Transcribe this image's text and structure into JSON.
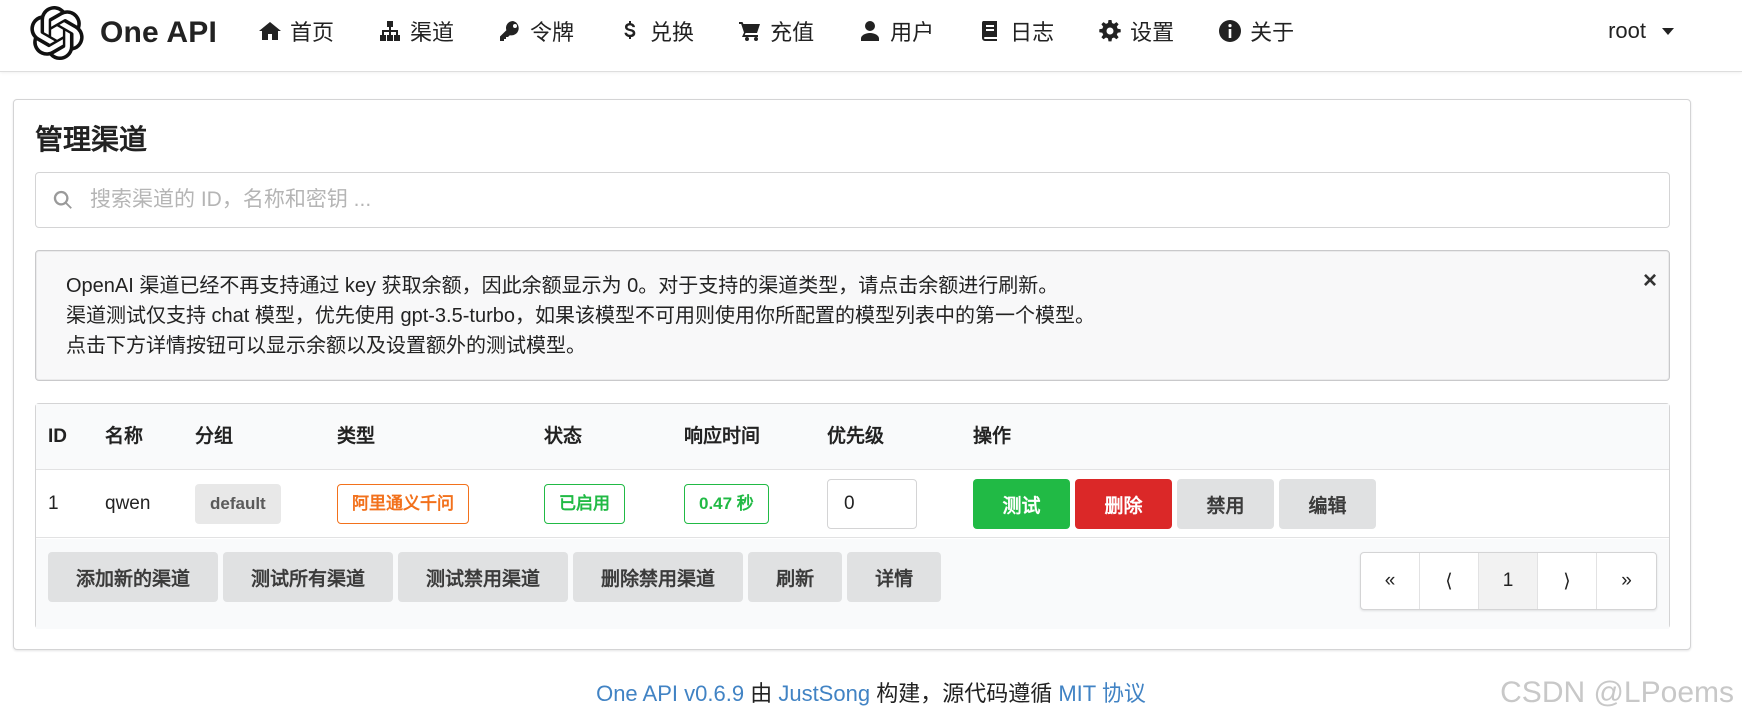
{
  "brand": {
    "name": "One API"
  },
  "nav": {
    "items": [
      {
        "label": "首页",
        "icon": "home-icon"
      },
      {
        "label": "渠道",
        "icon": "sitemap-icon"
      },
      {
        "label": "令牌",
        "icon": "key-icon"
      },
      {
        "label": "兑换",
        "icon": "dollar-icon"
      },
      {
        "label": "充值",
        "icon": "cart-icon"
      },
      {
        "label": "用户",
        "icon": "user-icon"
      },
      {
        "label": "日志",
        "icon": "book-icon"
      },
      {
        "label": "设置",
        "icon": "gear-icon"
      },
      {
        "label": "关于",
        "icon": "info-icon"
      }
    ],
    "user": "root"
  },
  "page": {
    "title": "管理渠道",
    "search_placeholder": "搜索渠道的 ID，名称和密钥 ..."
  },
  "notice": {
    "lines": [
      "OpenAI 渠道已经不再支持通过 key 获取余额，因此余额显示为 0。对于支持的渠道类型，请点击余额进行刷新。",
      "渠道测试仅支持 chat 模型，优先使用 gpt-3.5-turbo，如果该模型不可用则使用你所配置的模型列表中的第一个模型。",
      "点击下方详情按钮可以显示余额以及设置额外的测试模型。"
    ],
    "close": "×"
  },
  "table": {
    "headers": {
      "id": "ID",
      "name": "名称",
      "group": "分组",
      "type": "类型",
      "status": "状态",
      "response_time": "响应时间",
      "priority": "优先级",
      "actions": "操作"
    },
    "rows": [
      {
        "id": "1",
        "name": "qwen",
        "group": "default",
        "type": "阿里通义千问",
        "status": "已启用",
        "response_time": "0.47 秒",
        "priority": "0",
        "actions": {
          "test": "测试",
          "delete": "删除",
          "disable": "禁用",
          "edit": "编辑"
        }
      }
    ],
    "footer_buttons": {
      "add": "添加新的渠道",
      "test_all": "测试所有渠道",
      "test_disabled": "测试禁用渠道",
      "delete_disabled": "删除禁用渠道",
      "refresh": "刷新",
      "details": "详情"
    },
    "pagination": {
      "first": "«",
      "prev": "⟨",
      "current": "1",
      "next": "⟩",
      "last": "»"
    }
  },
  "footer": {
    "app_version": "One API v0.6.9",
    "by": "由",
    "author": "JustSong",
    "built": "构建，源代码遵循",
    "license": "MIT 协议"
  },
  "watermark": "CSDN @LPoems",
  "colors": {
    "green": "#21ba45",
    "red": "#db2828",
    "orange": "#f2711c",
    "link": "#4183c4",
    "grey_button": "#e0e1e2"
  }
}
